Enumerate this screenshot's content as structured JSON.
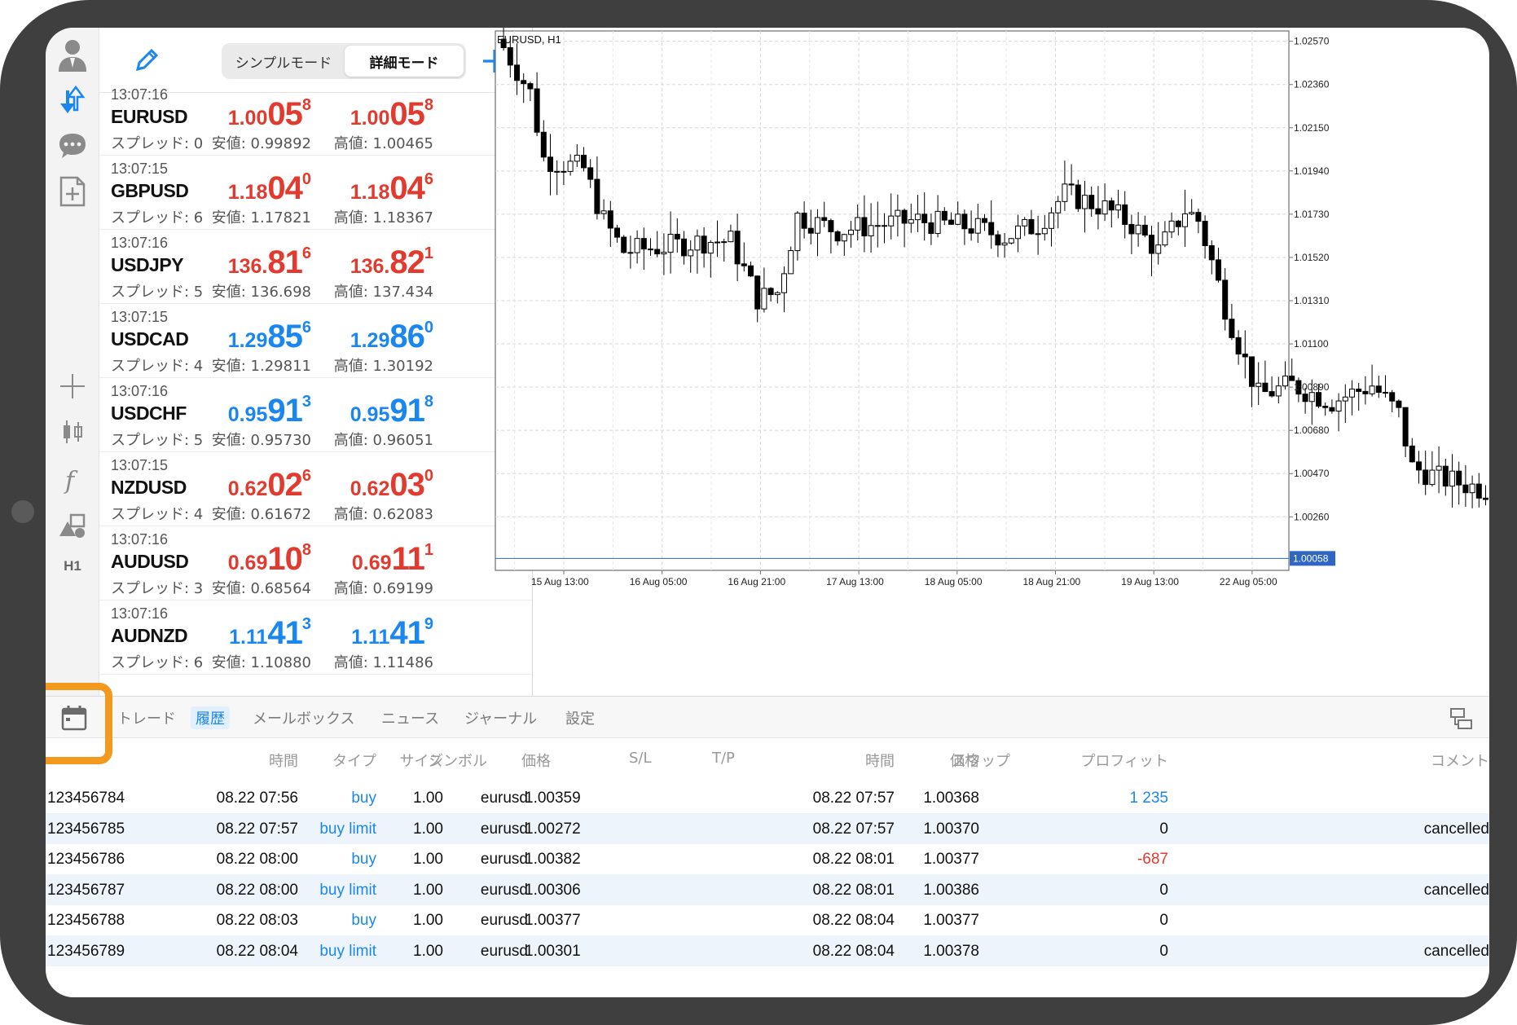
{
  "mode_toggle": {
    "simple": "シンプルモード",
    "detailed": "詳細モード"
  },
  "toolbar": {
    "timeframe": "H1"
  },
  "quotes": [
    {
      "time": "13:07:16",
      "symbol": "EURUSD",
      "spread": "スプレッド: 0",
      "color": "red",
      "bid": {
        "a": "1.00",
        "b": "05",
        "c": "8"
      },
      "ask": {
        "a": "1.00",
        "b": "05",
        "c": "8"
      },
      "low": "安値: 0.99892",
      "high": "高値: 1.00465"
    },
    {
      "time": "13:07:15",
      "symbol": "GBPUSD",
      "spread": "スプレッド: 6",
      "color": "red",
      "bid": {
        "a": "1.18",
        "b": "04",
        "c": "0"
      },
      "ask": {
        "a": "1.18",
        "b": "04",
        "c": "6"
      },
      "low": "安値: 1.17821",
      "high": "高値: 1.18367"
    },
    {
      "time": "13:07:16",
      "symbol": "USDJPY",
      "spread": "スプレッド: 5",
      "color": "red",
      "bid": {
        "a": "136.",
        "b": "81",
        "c": "6"
      },
      "ask": {
        "a": "136.",
        "b": "82",
        "c": "1"
      },
      "low": "安値: 136.698",
      "high": "高値: 137.434"
    },
    {
      "time": "13:07:15",
      "symbol": "USDCAD",
      "spread": "スプレッド: 4",
      "color": "blue",
      "bid": {
        "a": "1.29",
        "b": "85",
        "c": "6"
      },
      "ask": {
        "a": "1.29",
        "b": "86",
        "c": "0"
      },
      "low": "安値: 1.29811",
      "high": "高値: 1.30192"
    },
    {
      "time": "13:07:16",
      "symbol": "USDCHF",
      "spread": "スプレッド: 5",
      "color": "blue",
      "bid": {
        "a": "0.95",
        "b": "91",
        "c": "3"
      },
      "ask": {
        "a": "0.95",
        "b": "91",
        "c": "8"
      },
      "low": "安値: 0.95730",
      "high": "高値: 0.96051"
    },
    {
      "time": "13:07:15",
      "symbol": "NZDUSD",
      "spread": "スプレッド: 4",
      "color": "red",
      "bid": {
        "a": "0.62",
        "b": "02",
        "c": "6"
      },
      "ask": {
        "a": "0.62",
        "b": "03",
        "c": "0"
      },
      "low": "安値: 0.61672",
      "high": "高値: 0.62083"
    },
    {
      "time": "13:07:16",
      "symbol": "AUDUSD",
      "spread": "スプレッド: 3",
      "color": "red",
      "bid": {
        "a": "0.69",
        "b": "10",
        "c": "8"
      },
      "ask": {
        "a": "0.69",
        "b": "11",
        "c": "1"
      },
      "low": "安値: 0.68564",
      "high": "高値: 0.69199"
    },
    {
      "time": "13:07:16",
      "symbol": "AUDNZD",
      "spread": "スプレッド: 6",
      "color": "blue",
      "bid": {
        "a": "1.11",
        "b": "41",
        "c": "3"
      },
      "ask": {
        "a": "1.11",
        "b": "41",
        "c": "9"
      },
      "low": "安値: 1.10880",
      "high": "高値: 1.11486"
    }
  ],
  "chart": {
    "title": "EURUSD, H1",
    "y_ticks": [
      "1.02570",
      "1.02360",
      "1.02150",
      "1.01940",
      "1.01730",
      "1.01520",
      "1.01310",
      "1.01100",
      "1.00890",
      "1.00680",
      "1.00470",
      "1.00260"
    ],
    "current_price": "1.00058",
    "x_ticks": [
      "15 Aug 13:00",
      "16 Aug 05:00",
      "16 Aug 21:00",
      "17 Aug 13:00",
      "18 Aug 05:00",
      "18 Aug 21:00",
      "19 Aug 13:00",
      "22 Aug 05:00"
    ]
  },
  "chart_data": {
    "type": "candlestick",
    "symbol": "EURUSD",
    "timeframe": "H1",
    "ylim": [
      1.0,
      1.0262
    ],
    "x_tick_labels": [
      "15 Aug 13:00",
      "16 Aug 05:00",
      "16 Aug 21:00",
      "17 Aug 13:00",
      "18 Aug 05:00",
      "18 Aug 21:00",
      "19 Aug 13:00",
      "22 Aug 05:00"
    ],
    "current_price": 1.00058,
    "waypoints": [
      [
        0,
        1.0254
      ],
      [
        4,
        1.0232
      ],
      [
        6,
        1.02
      ],
      [
        12,
        1.0195
      ],
      [
        15,
        1.017
      ],
      [
        18,
        1.0155
      ],
      [
        26,
        1.0158
      ],
      [
        30,
        1.016
      ],
      [
        34,
        1.016
      ],
      [
        38,
        1.0132
      ],
      [
        41,
        1.0135
      ],
      [
        44,
        1.0172
      ],
      [
        50,
        1.0165
      ],
      [
        56,
        1.0168
      ],
      [
        62,
        1.017
      ],
      [
        66,
        1.0168
      ],
      [
        70,
        1.0167
      ],
      [
        75,
        1.0162
      ],
      [
        80,
        1.0168
      ],
      [
        84,
        1.0183
      ],
      [
        90,
        1.0176
      ],
      [
        94,
        1.0168
      ],
      [
        98,
        1.0155
      ],
      [
        102,
        1.0175
      ],
      [
        104,
        1.017
      ],
      [
        106,
        1.015
      ],
      [
        108,
        1.0128
      ],
      [
        110,
        1.011
      ],
      [
        113,
        1.0085
      ],
      [
        118,
        1.009
      ],
      [
        124,
        1.0082
      ],
      [
        130,
        1.009
      ],
      [
        134,
        1.0076
      ],
      [
        136,
        1.005
      ],
      [
        140,
        1.0045
      ],
      [
        146,
        1.004
      ],
      [
        152,
        1.0036
      ],
      [
        156,
        1.0045
      ],
      [
        158,
        1.004
      ],
      [
        162,
        1.0025
      ],
      [
        164,
        1.001
      ],
      [
        167,
        1.0007
      ]
    ]
  },
  "tabs": [
    "トレード",
    "履歴",
    "メールボックス",
    "ニュース",
    "ジャーナル",
    "設定"
  ],
  "active_tab": "履歴",
  "history": {
    "headers": {
      "open_time": "時間",
      "type": "タイプ",
      "size": "サイズ",
      "symbol": "シンボル",
      "open_price": "価格",
      "sl": "S/L",
      "tp": "T/P",
      "close_time": "時間",
      "close_price": "価格",
      "swap": "スワップ",
      "profit": "プロフィット",
      "comment": "コメント"
    },
    "rows": [
      {
        "ticket": "123456784",
        "open_time": "08.22 07:56",
        "type": "buy",
        "size": "1.00",
        "symbol": "eurusd",
        "open_price": "1.00359",
        "close_time": "08.22 07:57",
        "close_price": "1.00368",
        "profit": "1 235",
        "profit_color": "blue",
        "comment": ""
      },
      {
        "ticket": "123456785",
        "open_time": "08.22 07:57",
        "type": "buy limit",
        "size": "1.00",
        "symbol": "eurusd",
        "open_price": "1.00272",
        "close_time": "08.22 07:57",
        "close_price": "1.00370",
        "profit": "0",
        "profit_color": "black",
        "comment": "cancelled"
      },
      {
        "ticket": "123456786",
        "open_time": "08.22 08:00",
        "type": "buy",
        "size": "1.00",
        "symbol": "eurusd",
        "open_price": "1.00382",
        "close_time": "08.22 08:01",
        "close_price": "1.00377",
        "profit": "-687",
        "profit_color": "red",
        "comment": ""
      },
      {
        "ticket": "123456787",
        "open_time": "08.22 08:00",
        "type": "buy limit",
        "size": "1.00",
        "symbol": "eurusd",
        "open_price": "1.00306",
        "close_time": "08.22 08:01",
        "close_price": "1.00386",
        "profit": "0",
        "profit_color": "black",
        "comment": "cancelled"
      },
      {
        "ticket": "123456788",
        "open_time": "08.22 08:03",
        "type": "buy",
        "size": "1.00",
        "symbol": "eurusd",
        "open_price": "1.00377",
        "close_time": "08.22 08:04",
        "close_price": "1.00377",
        "profit": "0",
        "profit_color": "black",
        "comment": ""
      },
      {
        "ticket": "123456789",
        "open_time": "08.22 08:04",
        "type": "buy limit",
        "size": "1.00",
        "symbol": "eurusd",
        "open_price": "1.00301",
        "close_time": "08.22 08:04",
        "close_price": "1.00378",
        "profit": "0",
        "profit_color": "black",
        "comment": "cancelled"
      }
    ]
  },
  "colors": {
    "bid_ask_red": "#e23a2e",
    "bid_ask_blue": "#1a86f0",
    "highlight": "#f39a1e",
    "active_tab": "#1a86f0",
    "price_line": "#2f66c4"
  }
}
